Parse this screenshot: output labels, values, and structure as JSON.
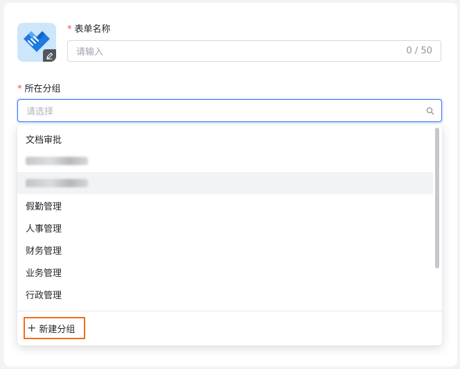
{
  "form": {
    "name_label": "表单名称",
    "name_placeholder": "请输入",
    "name_counter": "0 / 50",
    "group_label": "所在分组",
    "group_placeholder": "请选择"
  },
  "dropdown": {
    "options": [
      {
        "label": "文档审批",
        "redacted": false
      },
      {
        "label": "",
        "redacted": true
      },
      {
        "label": "",
        "redacted": true
      },
      {
        "label": "假勤管理",
        "redacted": false
      },
      {
        "label": "人事管理",
        "redacted": false
      },
      {
        "label": "财务管理",
        "redacted": false
      },
      {
        "label": "业务管理",
        "redacted": false
      },
      {
        "label": "行政管理",
        "redacted": false
      }
    ],
    "new_group_label": "新建分组"
  },
  "colors": {
    "accent": "#3370ff",
    "required": "#f54a45",
    "highlight_box": "#f26b1d",
    "icon_bg": "#cde6fb",
    "icon_blue": "#1f7ae0"
  },
  "icons": {
    "form_icon": "handshake-icon",
    "edit_badge": "pencil-icon",
    "search": "search-icon",
    "add": "plus-icon"
  }
}
